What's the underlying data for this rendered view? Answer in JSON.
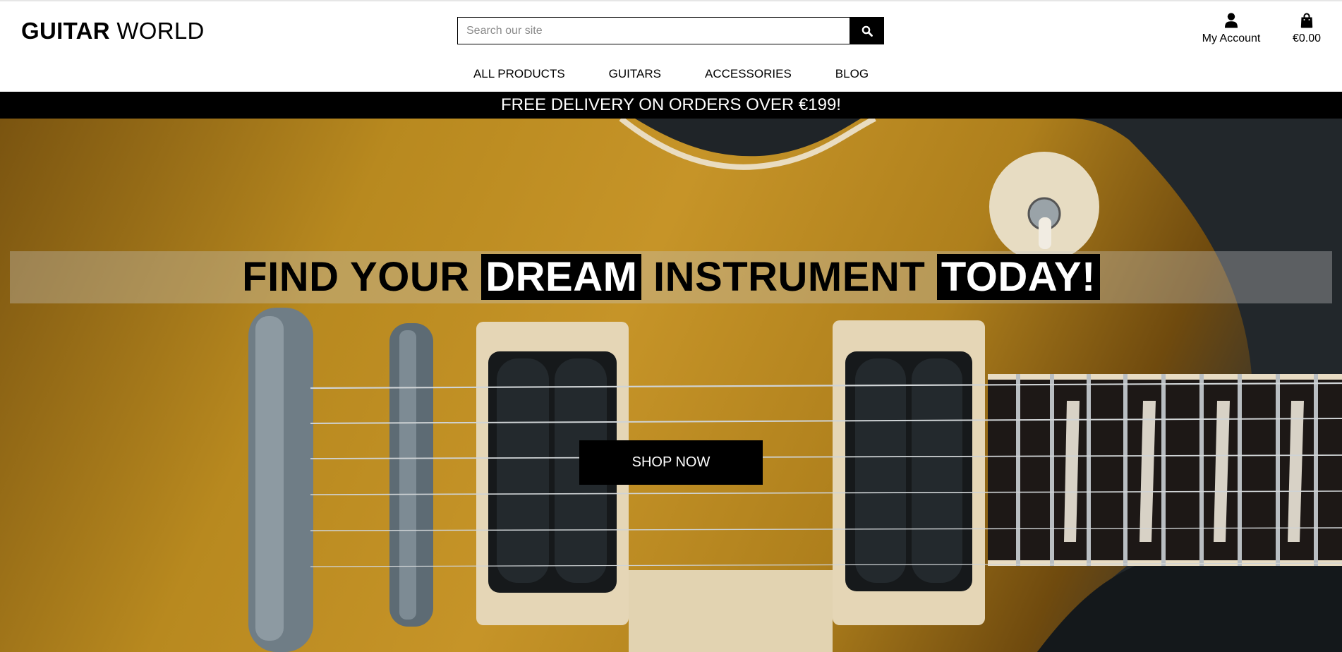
{
  "header": {
    "logo_bold": "GUITAR",
    "logo_light": "WORLD",
    "search": {
      "placeholder": "Search our site",
      "value": ""
    },
    "account_label": "My Account",
    "bag_total": "€0.00"
  },
  "nav": {
    "items": [
      {
        "label": "ALL PRODUCTS"
      },
      {
        "label": "GUITARS"
      },
      {
        "label": "ACCESSORIES"
      },
      {
        "label": "BLOG"
      }
    ]
  },
  "banner": {
    "text": "FREE DELIVERY ON ORDERS OVER €199!"
  },
  "hero": {
    "headline_1": "FIND YOUR",
    "headline_highlight_1": "DREAM",
    "headline_2": "INSTRUMENT",
    "headline_highlight_2": "TODAY!",
    "cta_label": "SHOP NOW",
    "image_subject": "electric guitar close-up (gold top, humbucker pickups)"
  },
  "icons": {
    "search": "search-icon",
    "account": "user-icon",
    "bag": "shopping-bag-icon"
  },
  "colors": {
    "primary": "#000000",
    "background": "#ffffff",
    "banner_text": "#ffffff"
  }
}
